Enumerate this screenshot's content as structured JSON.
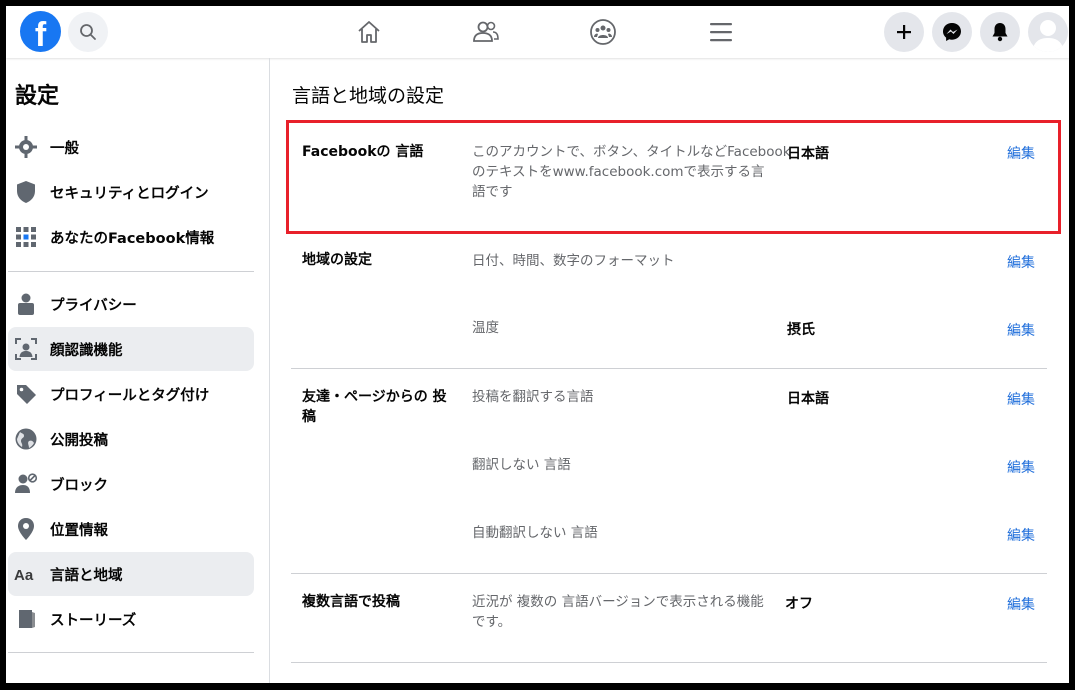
{
  "header": {
    "logo": "f",
    "icons": [
      "search-icon",
      "home-icon",
      "friends-icon",
      "groups-icon",
      "menu-icon",
      "plus-icon",
      "messenger-icon",
      "bell-icon",
      "avatar"
    ]
  },
  "sidebar": {
    "title": "設定",
    "items": [
      {
        "label": "一般",
        "icon": "gear-icon"
      },
      {
        "label": "セキュリティとログイン",
        "icon": "shield-icon"
      },
      {
        "label": "あなたのFacebook情報",
        "icon": "grid-icon"
      },
      {
        "label": "プライバシー",
        "icon": "lock-icon"
      },
      {
        "label": "顔認識機能",
        "icon": "face-scan-icon"
      },
      {
        "label": "プロフィールとタグ付け",
        "icon": "tag-icon"
      },
      {
        "label": "公開投稿",
        "icon": "globe-icon"
      },
      {
        "label": "ブロック",
        "icon": "block-user-icon"
      },
      {
        "label": "位置情報",
        "icon": "location-pin-icon"
      },
      {
        "label": "言語と地域",
        "icon": "aa-icon"
      },
      {
        "label": "ストーリーズ",
        "icon": "book-icon"
      }
    ]
  },
  "main": {
    "title": "言語と地域の設定",
    "edit_label": "編集",
    "sections": {
      "fb_language": {
        "title": "Facebookの 言語",
        "desc_line1": "このアカウントで、ボタン、タイトルなどFacebook",
        "desc_line2": "のテキストをwww.facebook.comで表示する言",
        "desc_line3": "語です",
        "value": "日本語"
      },
      "region": {
        "title": "地域の設定",
        "desc": "日付、時間、数字のフォーマット",
        "temp_label": "温度",
        "temp_value": "摂氏"
      },
      "friends_posts": {
        "title_line1": "友達・ページからの 投",
        "title_line2": "稿",
        "translate_label": "投稿を翻訳する言語",
        "translate_value": "日本語",
        "no_translate_label": "翻訳しない 言語",
        "no_auto_label": "自動翻訳しない 言語"
      },
      "multilingual": {
        "title": "複数言語で投稿",
        "desc_line1": "近況が 複数の 言語バージョンで表示される機能",
        "desc_line2": "です。",
        "value": "オフ"
      }
    }
  },
  "colors": {
    "accent": "#1877f2",
    "link": "#216fdb",
    "highlight_border": "#e8202a"
  }
}
